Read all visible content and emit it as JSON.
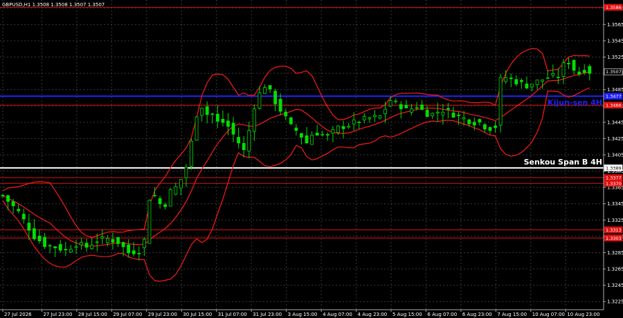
{
  "header": {
    "symbol_line": "GBPUSD,H1  1.3508 1.3508 1.3507 1.3507"
  },
  "chart_data": {
    "type": "candlestick",
    "symbol": "GBPUSD",
    "timeframe": "H1",
    "ylim": [
      1.3215,
      1.3595
    ],
    "y_ticks": [
      1.3225,
      1.3245,
      1.3265,
      1.3285,
      1.3305,
      1.3325,
      1.3345,
      1.3365,
      1.3385,
      1.3405,
      1.3425,
      1.3445,
      1.3465,
      1.3485,
      1.3505,
      1.3525,
      1.3545,
      1.3565,
      1.3585
    ],
    "x_ticks": [
      "27 Jul 2026",
      "27 Jul 23:00",
      "28 Jul 15:00",
      "29 Jul 07:00",
      "29 Jul 23:00",
      "30 Jul 15:00",
      "31 Jul 07:00",
      "31 Jul 23:00",
      "3 Aug 15:00",
      "4 Aug 07:00",
      "4 Aug 23:00",
      "5 Aug 15:00",
      "6 Aug 07:00",
      "6 Aug 23:00",
      "7 Aug 15:00",
      "10 Aug 07:00",
      "10 Aug 23:00"
    ],
    "close_points": [
      [
        0,
        1.3355
      ],
      [
        3,
        1.3335
      ],
      [
        6,
        1.3305
      ],
      [
        8,
        1.3295
      ],
      [
        10,
        1.3292
      ],
      [
        12,
        1.3288
      ],
      [
        14,
        1.3296
      ],
      [
        16,
        1.3292
      ],
      [
        18,
        1.33
      ],
      [
        20,
        1.3302
      ],
      [
        22,
        1.3298
      ],
      [
        24,
        1.3285
      ],
      [
        26,
        1.3288
      ],
      [
        27,
        1.33
      ],
      [
        28,
        1.3352
      ],
      [
        29,
        1.3355
      ],
      [
        30,
        1.3345
      ],
      [
        31,
        1.3345
      ],
      [
        32,
        1.336
      ],
      [
        33,
        1.3365
      ],
      [
        34,
        1.3375
      ],
      [
        35,
        1.339
      ],
      [
        36,
        1.342
      ],
      [
        37,
        1.3455
      ],
      [
        38,
        1.3465
      ],
      [
        39,
        1.3455
      ],
      [
        40,
        1.3455
      ],
      [
        41,
        1.3445
      ],
      [
        42,
        1.3445
      ],
      [
        43,
        1.344
      ],
      [
        44,
        1.343
      ],
      [
        45,
        1.342
      ],
      [
        46,
        1.341
      ],
      [
        47,
        1.3435
      ],
      [
        48,
        1.3465
      ],
      [
        49,
        1.348
      ],
      [
        50,
        1.349
      ],
      [
        51,
        1.3482
      ],
      [
        52,
        1.347
      ],
      [
        53,
        1.346
      ],
      [
        54,
        1.345
      ],
      [
        55,
        1.344
      ],
      [
        56,
        1.3435
      ],
      [
        57,
        1.3428
      ],
      [
        58,
        1.342
      ],
      [
        59,
        1.343
      ],
      [
        60,
        1.3432
      ],
      [
        61,
        1.343
      ],
      [
        62,
        1.3428
      ],
      [
        64,
        1.3438
      ],
      [
        66,
        1.3442
      ],
      [
        68,
        1.3447
      ],
      [
        70,
        1.345
      ],
      [
        72,
        1.3452
      ],
      [
        73,
        1.3462
      ],
      [
        74,
        1.3472
      ],
      [
        75,
        1.3468
      ],
      [
        76,
        1.3465
      ],
      [
        77,
        1.346
      ],
      [
        78,
        1.3462
      ],
      [
        79,
        1.3465
      ],
      [
        80,
        1.346
      ],
      [
        81,
        1.3456
      ],
      [
        82,
        1.3455
      ],
      [
        83,
        1.3458
      ],
      [
        84,
        1.346
      ],
      [
        85,
        1.3458
      ],
      [
        86,
        1.3455
      ],
      [
        87,
        1.3452
      ],
      [
        88,
        1.345
      ],
      [
        89,
        1.3447
      ],
      [
        90,
        1.3445
      ],
      [
        91,
        1.3445
      ],
      [
        92,
        1.344
      ],
      [
        93,
        1.3438
      ],
      [
        94,
        1.344
      ],
      [
        95,
        1.3497
      ],
      [
        96,
        1.35
      ],
      [
        98,
        1.3495
      ],
      [
        100,
        1.349
      ],
      [
        102,
        1.3495
      ],
      [
        104,
        1.35
      ],
      [
        106,
        1.3502
      ],
      [
        107,
        1.3515
      ],
      [
        108,
        1.352
      ],
      [
        109,
        1.351
      ],
      [
        110,
        1.3505
      ],
      [
        111,
        1.351
      ],
      [
        112,
        1.3507
      ]
    ],
    "indicator_lines": [
      {
        "name": "Senkou Span B 4H",
        "value": 1.3389,
        "color": "#ffffff"
      },
      {
        "name": "Kijun-sen 4H",
        "value": 1.3477,
        "color": "#2020ff"
      }
    ],
    "support_resistance": [
      1.3586,
      1.3466,
      1.3377,
      1.337,
      1.3313,
      1.3303
    ],
    "price_tags": [
      {
        "text": "1.3586",
        "value": 1.3586,
        "color": "#e01010"
      },
      {
        "text": "1.3507",
        "value": 1.3507,
        "color": "#000000"
      },
      {
        "text": "1.3477",
        "value": 1.3477,
        "color": "#2020ff"
      },
      {
        "text": "1.3466",
        "value": 1.3466,
        "color": "#e01010"
      },
      {
        "text": "1.3389",
        "value": 1.3389,
        "color": "#ffffff"
      },
      {
        "text": "1.3377",
        "value": 1.3377,
        "color": "#e01010"
      },
      {
        "text": "1.3370",
        "value": 1.337,
        "color": "#e01010"
      },
      {
        "text": "1.3313",
        "value": 1.3313,
        "color": "#e01010"
      },
      {
        "text": "1.3303",
        "value": 1.3303,
        "color": "#e01010"
      }
    ],
    "colors": {
      "up": "#00e000",
      "down": "#00e000",
      "bollinger": "#ff1a1a",
      "kijun_h1": "#ff1a1a",
      "senkou_line": "#ffffff",
      "kijun_line": "#2020ff",
      "level": "#e01010",
      "grid": "#3a3a3a",
      "axis": "#b0b0b0"
    }
  }
}
